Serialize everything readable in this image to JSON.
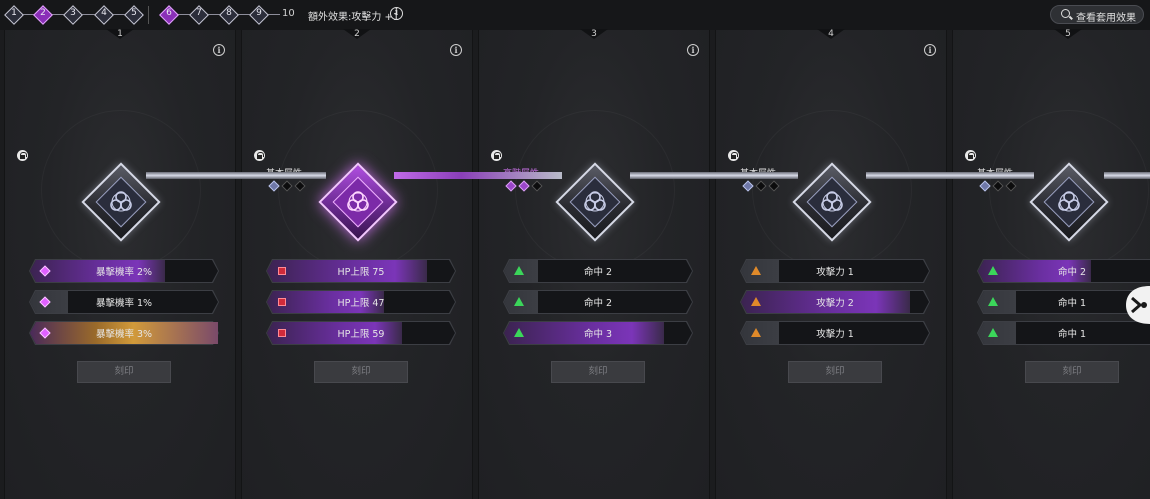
{
  "topbar": {
    "steps": [
      {
        "num": "1",
        "active": false
      },
      {
        "num": "2",
        "active": true
      },
      {
        "num": "3",
        "active": false
      },
      {
        "num": "4",
        "active": false
      },
      {
        "num": "5",
        "active": false
      },
      {
        "num": "6",
        "active": true
      },
      {
        "num": "7",
        "active": false
      },
      {
        "num": "8",
        "active": false
      },
      {
        "num": "9",
        "active": false
      }
    ],
    "final_num": "10",
    "bonus_text": "額外效果:攻擊力 +1",
    "info_glyph": "i",
    "view_button_label": "查看套用效果"
  },
  "panels": [
    {
      "number": "1",
      "info_glyph": "i",
      "locked": true,
      "attr_title": "",
      "attr_type": "none",
      "pips": [],
      "emblem": "normal",
      "stats": [
        {
          "icon": "diamond",
          "label": "暴擊機率 2%",
          "fill": 0.72,
          "color": "purple"
        },
        {
          "icon": "diamond",
          "label": "暴擊機率 1%",
          "fill": 0.2,
          "color": "gray"
        },
        {
          "icon": "diamond",
          "label": "暴擊機率 3%",
          "fill": 1.0,
          "color": "gold"
        }
      ],
      "button_label": "刻印"
    },
    {
      "number": "2",
      "info_glyph": "i",
      "locked": true,
      "attr_title": "基本屬性",
      "attr_type": "basic",
      "pips": [
        "blue",
        "dark",
        "dark"
      ],
      "emblem": "active",
      "stats": [
        {
          "icon": "square",
          "label": "HP上限 75",
          "fill": 0.85,
          "color": "purple"
        },
        {
          "icon": "square",
          "label": "HP上限 47",
          "fill": 0.62,
          "color": "purple"
        },
        {
          "icon": "square",
          "label": "HP上限 59",
          "fill": 0.72,
          "color": "purple"
        }
      ],
      "button_label": "刻印"
    },
    {
      "number": "3",
      "info_glyph": "i",
      "locked": true,
      "attr_title": "高階屬性",
      "attr_type": "advanced",
      "pips": [
        "purple",
        "purple",
        "dark"
      ],
      "emblem": "normal",
      "stats": [
        {
          "icon": "tri-green",
          "label": "命中 2",
          "fill": 0.18,
          "color": "gray"
        },
        {
          "icon": "tri-green",
          "label": "命中 2",
          "fill": 0.18,
          "color": "gray"
        },
        {
          "icon": "tri-green",
          "label": "命中 3",
          "fill": 0.85,
          "color": "purple"
        }
      ],
      "button_label": "刻印"
    },
    {
      "number": "4",
      "info_glyph": "i",
      "locked": true,
      "attr_title": "基本屬性",
      "attr_type": "basic",
      "pips": [
        "blue",
        "dark",
        "dark"
      ],
      "emblem": "normal",
      "stats": [
        {
          "icon": "tri-orange",
          "label": "攻擊力 1",
          "fill": 0.2,
          "color": "gray"
        },
        {
          "icon": "tri-orange",
          "label": "攻擊力 2",
          "fill": 0.9,
          "color": "purple"
        },
        {
          "icon": "tri-orange",
          "label": "攻擊力 1",
          "fill": 0.2,
          "color": "gray"
        }
      ],
      "button_label": "刻印"
    },
    {
      "number": "5",
      "info_glyph": "i",
      "locked": true,
      "attr_title": "基本屬性",
      "attr_type": "basic",
      "pips": [
        "blue",
        "dark",
        "dark"
      ],
      "emblem": "normal",
      "stats": [
        {
          "icon": "tri-green",
          "label": "命中 2",
          "fill": 0.6,
          "color": "purple"
        },
        {
          "icon": "tri-green",
          "label": "命中 1",
          "fill": 0.2,
          "color": "gray"
        },
        {
          "icon": "tri-green",
          "label": "命中 1",
          "fill": 0.2,
          "color": "gray"
        }
      ],
      "button_label": "刻印"
    }
  ],
  "colors": {
    "accent_purple": "#9a46c9",
    "gold": "#c98a2a",
    "panel_bg": "#232427"
  }
}
